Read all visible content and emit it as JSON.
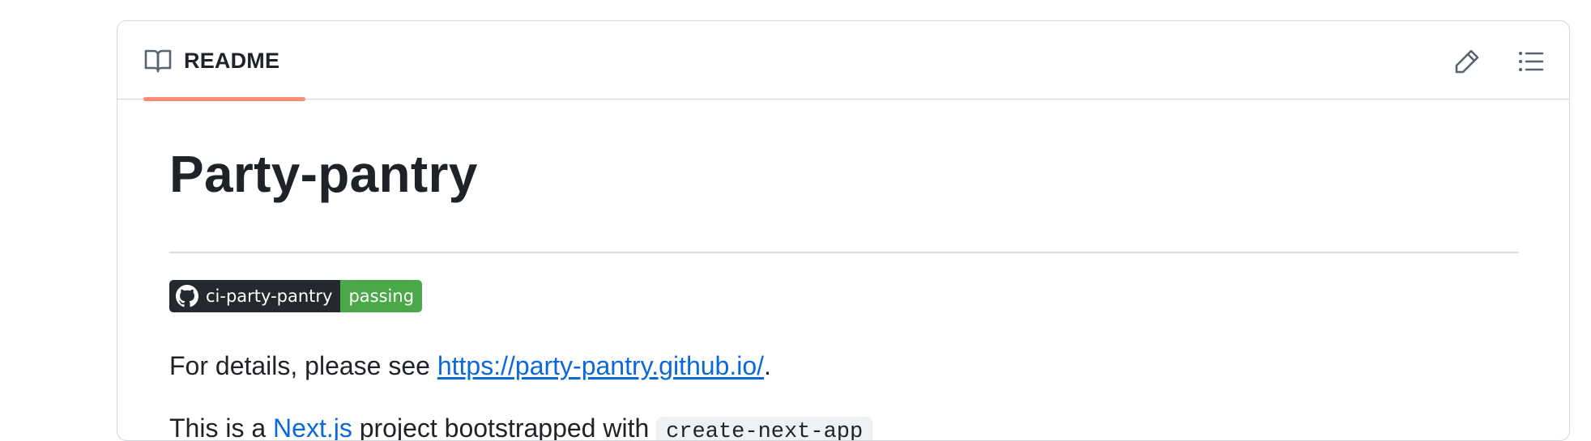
{
  "readme": {
    "tab_label": "README",
    "icons": {
      "tab": "book-icon",
      "edit": "pencil-icon",
      "toc": "list-unordered-icon",
      "badge": "github-mark-icon"
    },
    "colors": {
      "tab_underline": "#fd8c73",
      "link": "#0969da",
      "badge_left": "#24292f",
      "badge_right": "#4aa849"
    }
  },
  "content": {
    "title": "Party-pantry",
    "badge": {
      "label": "ci-party-pantry",
      "status": "passing"
    },
    "paragraph1": {
      "before": "For details, please see ",
      "link_text": "https://party-pantry.github.io/",
      "after": "."
    },
    "paragraph2": {
      "before": "This is a ",
      "link_text": "Next.js",
      "after": " project bootstrapped with ",
      "code": "create-next-app"
    }
  }
}
